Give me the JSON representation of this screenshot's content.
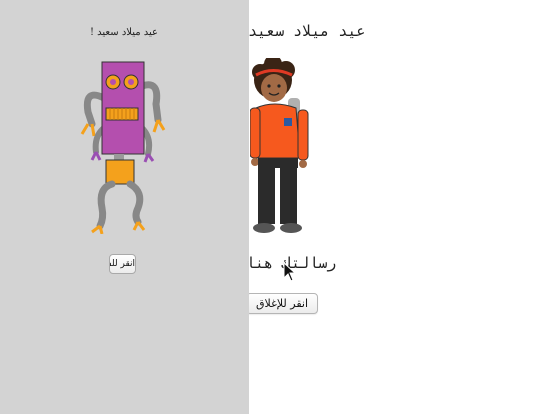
{
  "inside": {
    "title": "عيد ميلاد سعيد",
    "message": "رسالتك هنا",
    "close_button": "انقر للإغلاق"
  },
  "cover": {
    "title": "عيد ميلاد سعيد !",
    "open_button": "انقر للفتح"
  },
  "colors": {
    "cover_bg": "#d3d3d3",
    "page_bg": "#ffffff",
    "robot_body": "#b44fae",
    "robot_accent": "#f4a11c",
    "kid_shirt": "#f6591e"
  },
  "icons": {
    "cursor": "arrow-cursor-icon"
  }
}
